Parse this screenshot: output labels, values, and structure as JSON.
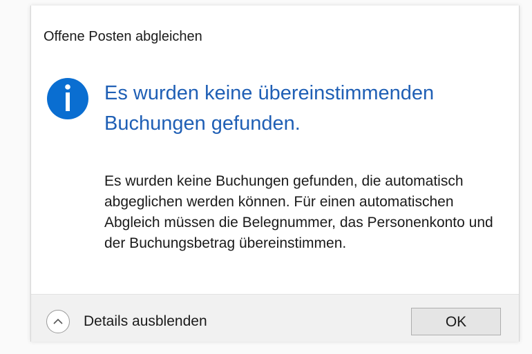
{
  "dialog": {
    "title": "Offene Posten abgleichen",
    "icon": "info-icon",
    "main_instruction": "Es wurden keine übereinstimmenden Buchungen gefunden.",
    "content": "Es wurden keine Buchungen gefunden, die automatisch abgeglichen werden können. Für einen automatischen Abgleich müssen die Belegnummer, das Personenkonto und der Buchungsbetrag übereinstimmen.",
    "footer": {
      "expando_label": "Details ausblenden",
      "ok_label": "OK"
    }
  },
  "colors": {
    "main_instruction": "#1f5fb5",
    "info_icon": "#0a6ed1",
    "footer_background": "#f1f1f1"
  }
}
